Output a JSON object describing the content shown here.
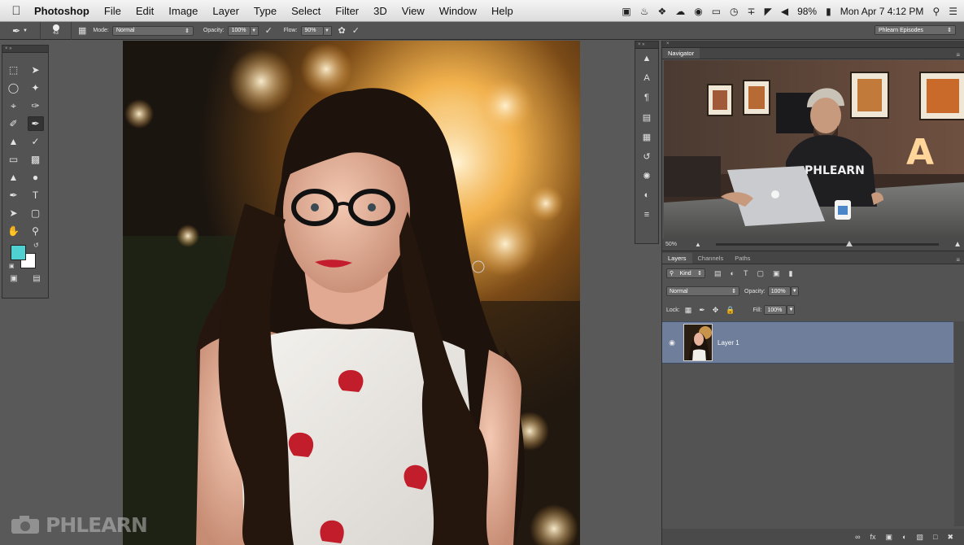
{
  "menubar": {
    "app_name": "Photoshop",
    "items": [
      "File",
      "Edit",
      "Image",
      "Layer",
      "Type",
      "Select",
      "Filter",
      "3D",
      "View",
      "Window",
      "Help"
    ],
    "battery": "98%",
    "clock": "Mon Apr 7  4:12 PM"
  },
  "options": {
    "brush_size": "43",
    "mode_label": "Mode:",
    "mode_value": "Normal",
    "opacity_label": "Opacity:",
    "opacity_value": "100%",
    "flow_label": "Flow:",
    "flow_value": "90%",
    "workspace": "Phlearn Episodes"
  },
  "colors": {
    "foreground": "#4fd1d1",
    "background": "#ffffff",
    "selection": "#6f7e9a"
  },
  "navigator": {
    "tab": "Navigator",
    "zoom": "50%",
    "zoom_level": 0.6,
    "preview_logo_text": "PHLEARN",
    "preview_sign": "A"
  },
  "layers": {
    "tabs": [
      "Layers",
      "Channels",
      "Paths"
    ],
    "filter_kind": "Kind",
    "blend_mode": "Normal",
    "opacity_label": "Opacity:",
    "opacity_value": "100%",
    "lock_label": "Lock:",
    "fill_label": "Fill:",
    "fill_value": "100%",
    "items": [
      {
        "name": "Layer 1",
        "visible": true,
        "selected": true
      }
    ]
  },
  "watermark": {
    "text": "PHLEARN"
  }
}
